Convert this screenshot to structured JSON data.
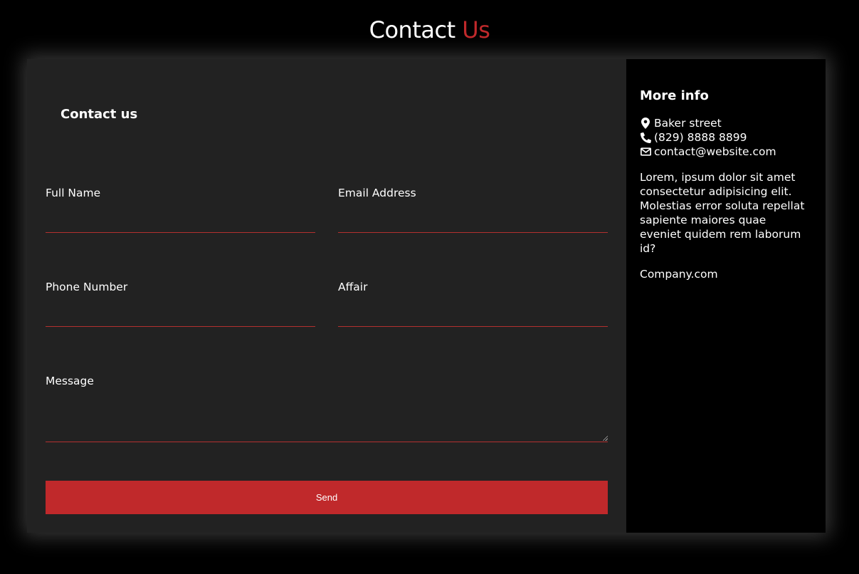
{
  "header": {
    "title_main": "Contact",
    "title_accent": "Us"
  },
  "form": {
    "heading": "Contact us",
    "fields": {
      "full_name": {
        "label": "Full Name",
        "value": ""
      },
      "email": {
        "label": "Email Address",
        "value": ""
      },
      "phone": {
        "label": "Phone Number",
        "value": ""
      },
      "affair": {
        "label": "Affair",
        "value": ""
      },
      "message": {
        "label": "Message",
        "value": ""
      }
    },
    "send_label": "Send"
  },
  "info": {
    "title": "More info",
    "address": "Baker street",
    "phone": "(829) 8888 8899",
    "email": "contact@website.com",
    "description": "Lorem, ipsum dolor sit amet consectetur adipisicing elit. Molestias error soluta repellat sapiente maiores quae eveniet quidem rem laborum id?",
    "site": "Company.com",
    "icons": [
      "map-marker-icon",
      "phone-icon",
      "envelope-icon"
    ]
  },
  "colors": {
    "accent": "#c0292b",
    "background": "#000000",
    "panel": "#222222",
    "underline": "#b3302f"
  }
}
